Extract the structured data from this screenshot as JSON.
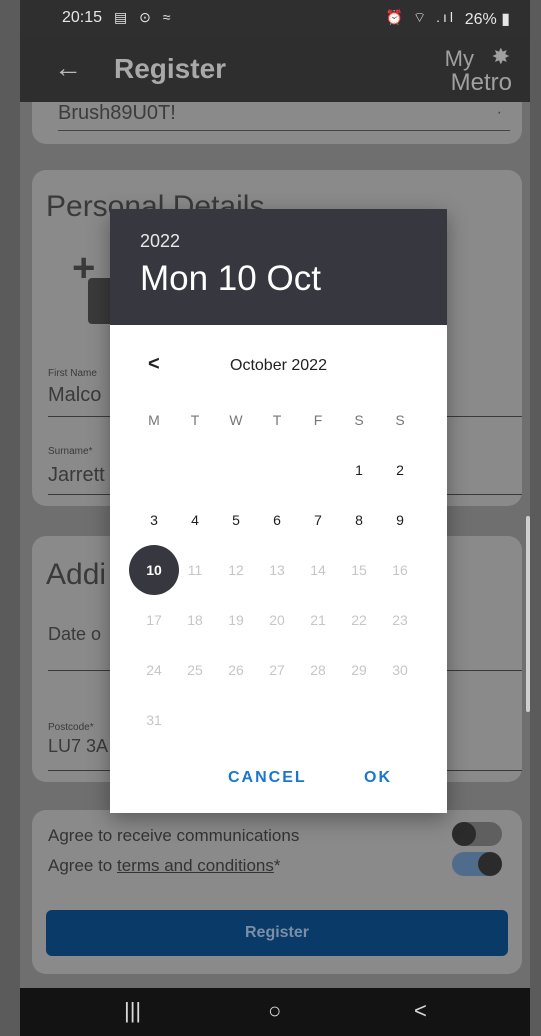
{
  "status_bar": {
    "time": "20:15",
    "left_icons": "▤ ⊙ ≈",
    "right_icons": "⏰ ⌔ .ıl",
    "battery": "26%",
    "battery_icon": "battery-icon"
  },
  "app_bar": {
    "back_icon": "←",
    "title": "Register",
    "logo_my": "My",
    "logo_mark": "✸",
    "logo_metro": "Metro"
  },
  "background": {
    "password_value": "Brush89U0T!",
    "personal_details": {
      "title": "Personal Details",
      "first_name_label": "First Name",
      "first_name_value": "Malco",
      "surname_label": "Surname*",
      "surname_value": "Jarrett"
    },
    "additional": {
      "title": "Addi",
      "date_of_birth_label": "Date o",
      "postcode_label": "Postcode*",
      "postcode_value": "LU7 3A"
    },
    "consents": {
      "communications_label": "Agree to receive communications",
      "terms_prefix": "Agree to ",
      "terms_link": "terms and conditions",
      "terms_suffix": "*",
      "communications_on": false,
      "terms_on": true
    },
    "register_button": "Register"
  },
  "date_picker": {
    "year": "2022",
    "selected_date": "Mon 10 Oct",
    "prev_month_icon": "<",
    "month_label": "October 2022",
    "weekdays": [
      "M",
      "T",
      "W",
      "T",
      "F",
      "S",
      "S"
    ],
    "weeks": [
      [
        "",
        "",
        "",
        "",
        "",
        "1",
        "2"
      ],
      [
        "3",
        "4",
        "5",
        "6",
        "7",
        "8",
        "9"
      ],
      [
        "10",
        "11",
        "12",
        "13",
        "14",
        "15",
        "16"
      ],
      [
        "17",
        "18",
        "19",
        "20",
        "21",
        "22",
        "23"
      ],
      [
        "24",
        "25",
        "26",
        "27",
        "28",
        "29",
        "30"
      ],
      [
        "31",
        "",
        "",
        "",
        "",
        "",
        ""
      ]
    ],
    "selected_day": "10",
    "max_enabled_day": 10,
    "cancel_label": "CANCEL",
    "ok_label": "OK"
  },
  "nav_bar": {
    "recents": "|||",
    "home": "○",
    "back": "<"
  },
  "colors": {
    "dialog_header": "#37373f",
    "accent": "#1976d2",
    "register_button": "#0a3a68"
  }
}
